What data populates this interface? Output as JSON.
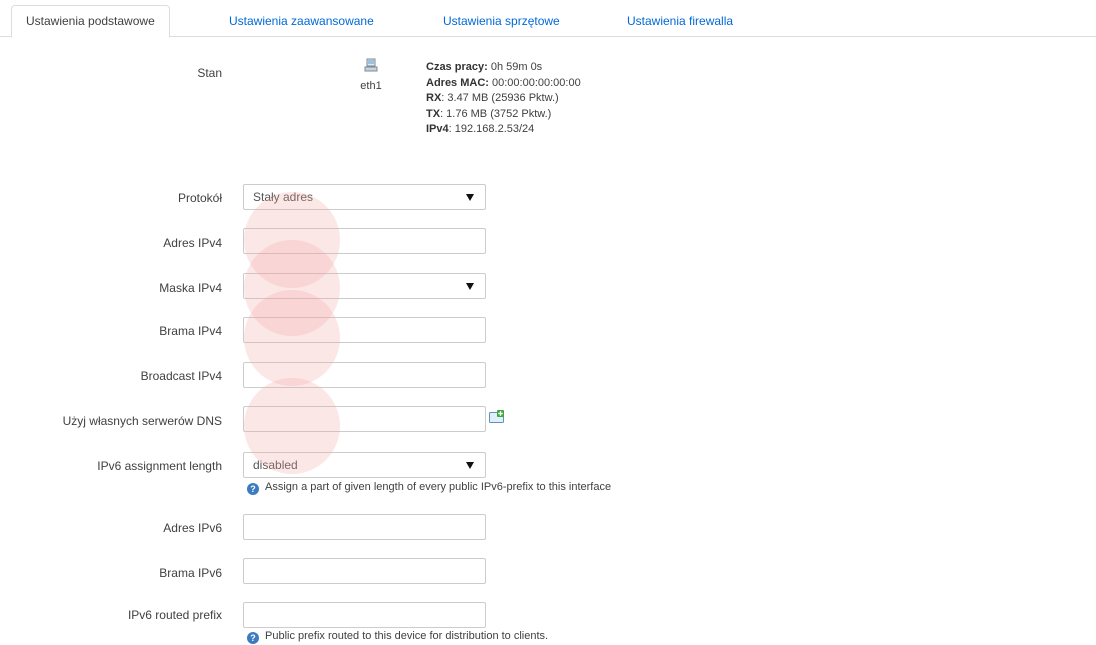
{
  "tabs": [
    {
      "label": "Ustawienia podstawowe",
      "active": true
    },
    {
      "label": "Ustawienia zaawansowane"
    },
    {
      "label": "Ustawienia sprzętowe"
    },
    {
      "label": "Ustawienia firewalla"
    }
  ],
  "status": {
    "label": "Stan",
    "interface_name": "eth1",
    "uptime_label": "Czas pracy:",
    "uptime_value": " 0h 59m 0s",
    "mac_label": "Adres MAC:",
    "mac_value": " 00:00:00:00:00:00",
    "rx_label": "RX",
    "rx_value": ": 3.47 MB (25936 Pktw.)",
    "tx_label": "TX",
    "tx_value": ": 1.76 MB (3752 Pktw.)",
    "ipv4_label": "IPv4",
    "ipv4_value": ": 192.168.2.53/24"
  },
  "form": {
    "protocol": {
      "label": "Protokół",
      "value": "Stały adres"
    },
    "ipv4_address": {
      "label": "Adres IPv4",
      "value": ""
    },
    "ipv4_netmask": {
      "label": "Maska IPv4",
      "value": ""
    },
    "ipv4_gateway": {
      "label": "Brama IPv4",
      "value": ""
    },
    "ipv4_broadcast": {
      "label": "Broadcast IPv4",
      "value": ""
    },
    "custom_dns": {
      "label": "Użyj własnych serwerów DNS",
      "value": ""
    },
    "ip6assign": {
      "label": "IPv6 assignment length",
      "value": "disabled",
      "hint": "Assign a part of given length of every public IPv6-prefix to this interface"
    },
    "ipv6_address": {
      "label": "Adres IPv6",
      "value": ""
    },
    "ipv6_gateway": {
      "label": "Brama IPv6",
      "value": ""
    },
    "ipv6_prefix": {
      "label": "IPv6 routed prefix",
      "value": "",
      "hint": "Public prefix routed to this device for distribution to clients."
    }
  },
  "icons": {
    "interface": "network-interface-icon",
    "add": "add-icon",
    "help": "help-icon"
  },
  "colors": {
    "link": "#0069d6",
    "border": "#cccccc",
    "help": "#3b7bbf"
  }
}
